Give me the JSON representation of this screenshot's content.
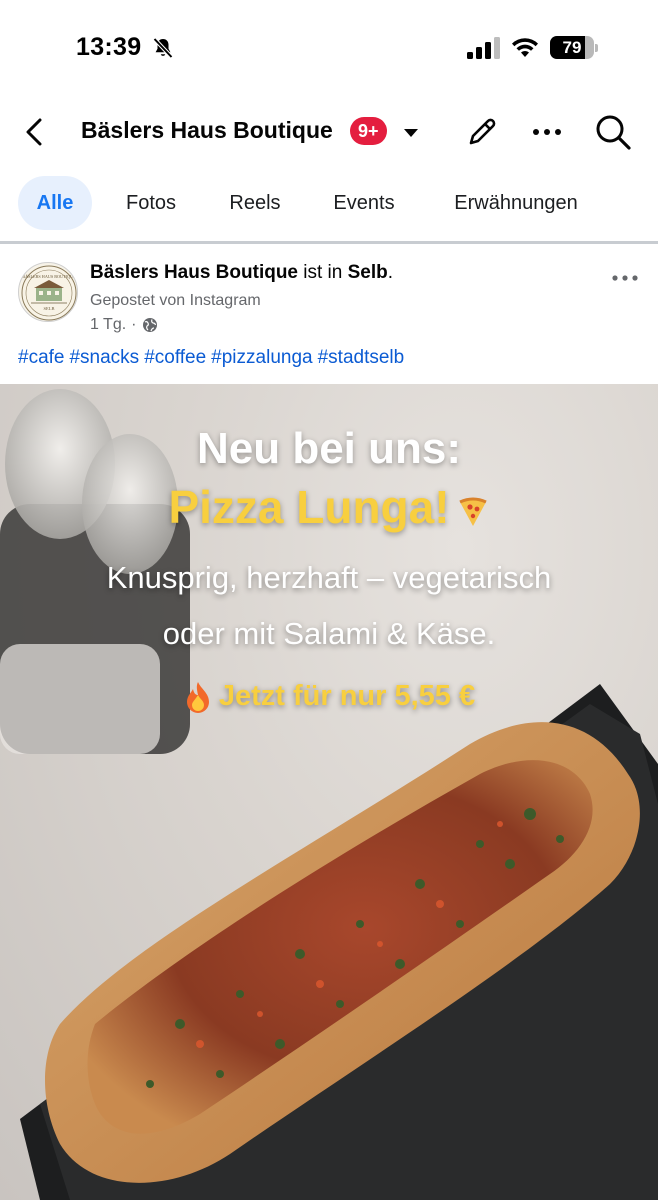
{
  "status_bar": {
    "time": "13:39",
    "battery_level": 79,
    "icons": [
      "bell-off-icon",
      "signal-icon",
      "wifi-icon",
      "battery-icon"
    ]
  },
  "header": {
    "title": "Bäslers Haus Boutique",
    "badge": "9+",
    "icons": [
      "back-arrow-icon",
      "chevron-down-icon",
      "pencil-icon",
      "more-horizontal-icon",
      "search-icon"
    ],
    "accent": "#e41e3f"
  },
  "tabs": [
    {
      "label": "Alle",
      "active": true
    },
    {
      "label": "Fotos",
      "active": false
    },
    {
      "label": "Reels",
      "active": false
    },
    {
      "label": "Events",
      "active": false
    },
    {
      "label": "Erwähnungen",
      "active": false
    }
  ],
  "post": {
    "author": "Bäslers Haus Boutique",
    "location_prefix": " ist in ",
    "location": "Selb",
    "location_suffix": ".",
    "posted_via": "Gepostet von Instagram",
    "time": "1 Tg.",
    "separator": "·",
    "audience_icon": "globe-icon",
    "hashtags": [
      "#cafe",
      "#snacks",
      "#coffee",
      "#pizzalunga",
      "#stadtselb"
    ],
    "avatar_text_top": "BÄSLERS HAUS BOUTIQUE",
    "avatar_text_bottom": "SELB",
    "image": {
      "headline": "Neu bei uns:",
      "product": "Pizza Lunga!",
      "line1": "Knusprig, herzhaft – vegetarisch",
      "line2": "oder mit Salami & Käse.",
      "price": "Jetzt für nur 5,55 €",
      "highlight_color": "#f8cf3f"
    }
  }
}
